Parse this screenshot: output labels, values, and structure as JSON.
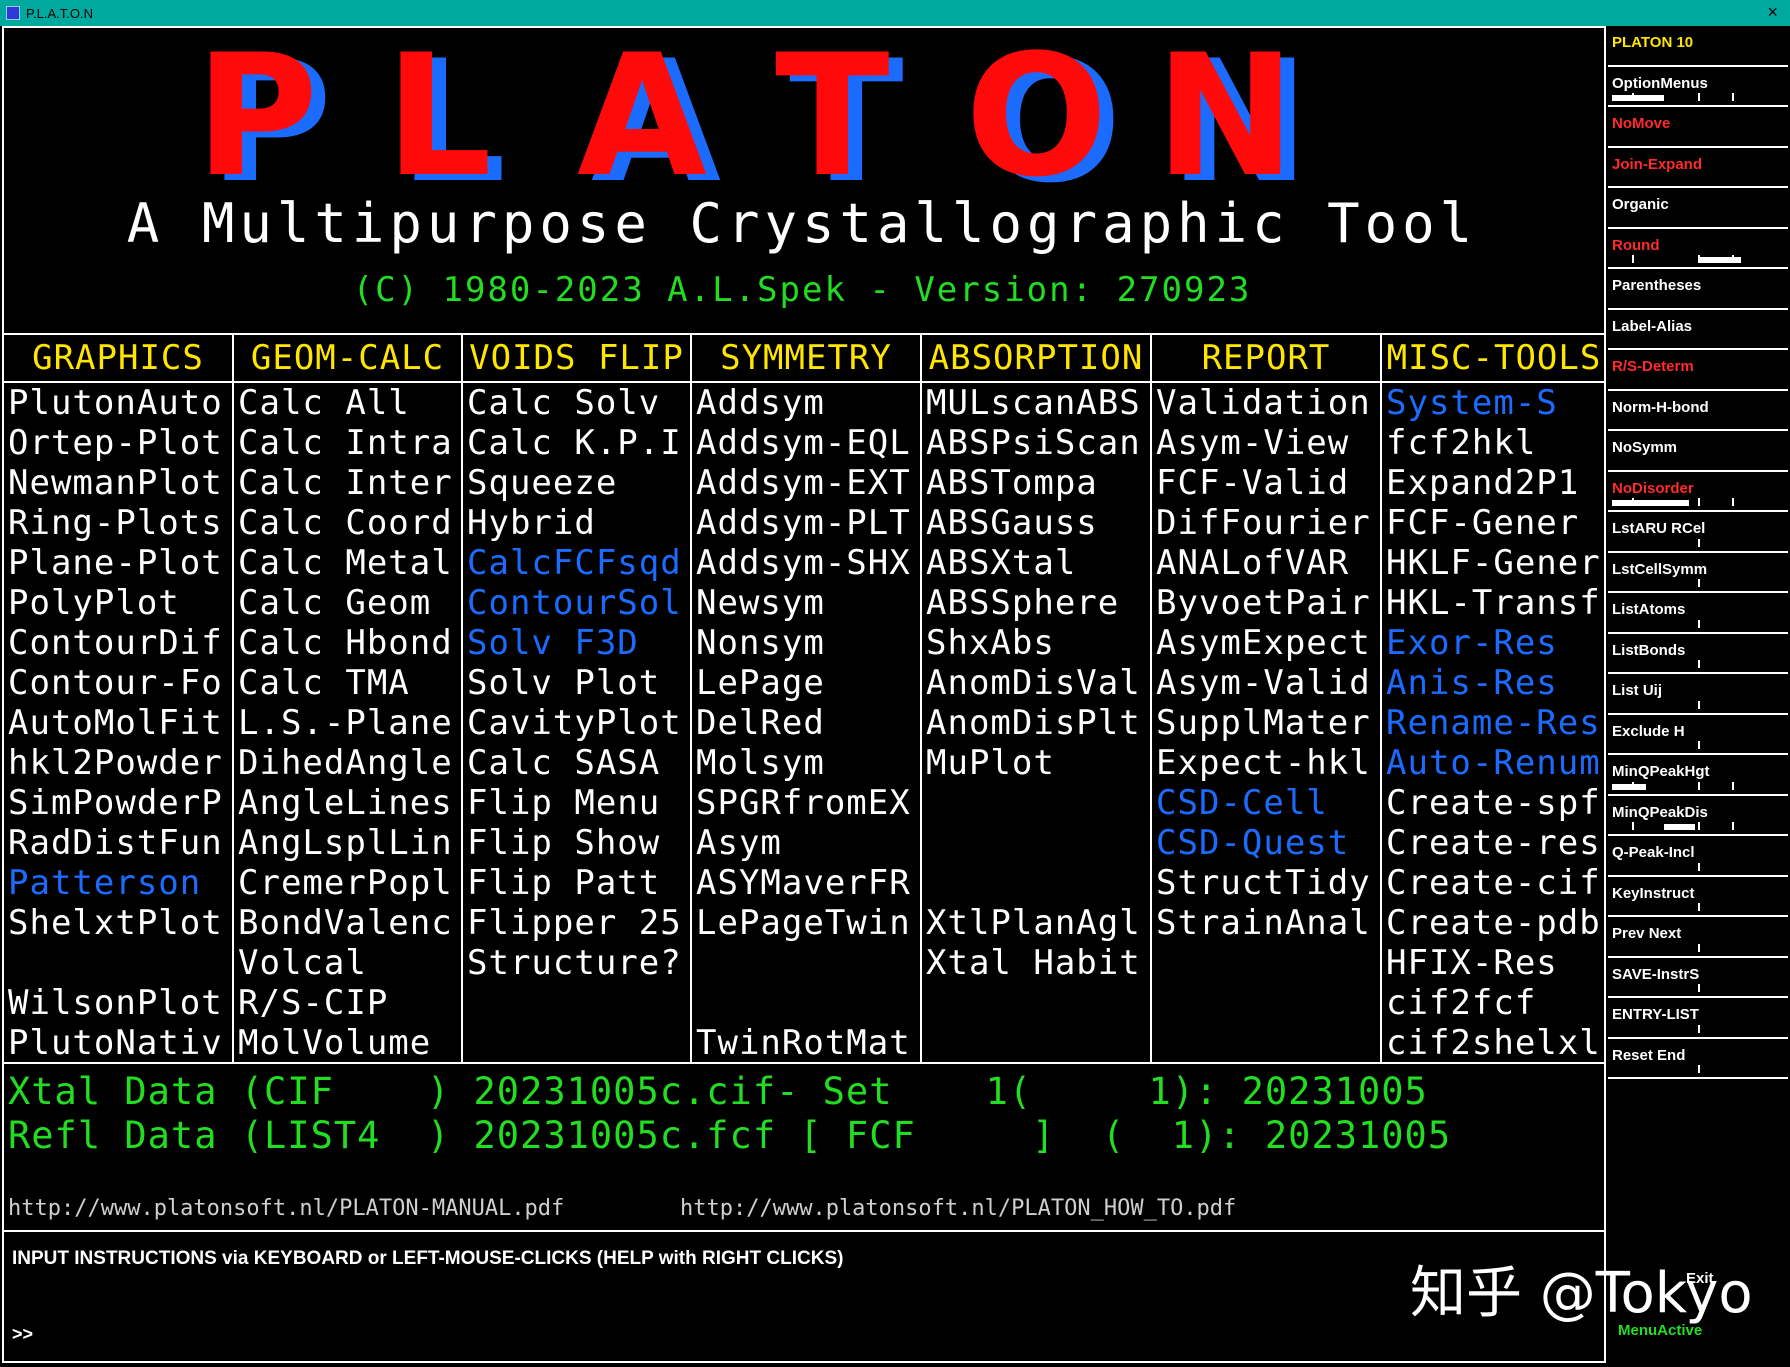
{
  "window": {
    "title": "P.L.A.T.O.N",
    "close_glyph": "×"
  },
  "logo": {
    "letters": [
      "P",
      "L",
      "A",
      "T",
      "O",
      "N"
    ],
    "colors": {
      "primary": "#ff0a0a",
      "shadow": "#1c6bff"
    }
  },
  "subtitle": "A Multipurpose Crystallographic Tool",
  "copyright": "(C) 1980-2023 A.L.Spek - Version: 270923",
  "colors": {
    "header": "#ffe600",
    "green": "#22dd22",
    "blue": "#1c6bff",
    "red": "#ff2a2a",
    "white": "#ffffff"
  },
  "columns": [
    {
      "header": "GRAPHICS",
      "items": [
        {
          "t": "PlutonAuto"
        },
        {
          "t": "Ortep-Plot"
        },
        {
          "t": "NewmanPlot"
        },
        {
          "t": "Ring-Plots"
        },
        {
          "t": "Plane-Plot"
        },
        {
          "t": "PolyPlot"
        },
        {
          "t": "ContourDif"
        },
        {
          "t": "Contour-Fo"
        },
        {
          "t": "AutoMolFit"
        },
        {
          "t": "hkl2Powder"
        },
        {
          "t": "SimPowderP"
        },
        {
          "t": "RadDistFun"
        },
        {
          "t": "Patterson",
          "c": "blue"
        },
        {
          "t": "ShelxtPlot"
        },
        {
          "t": ""
        },
        {
          "t": "WilsonPlot"
        },
        {
          "t": "PlutoNativ"
        }
      ]
    },
    {
      "header": "GEOM-CALC",
      "items": [
        {
          "t": "Calc All"
        },
        {
          "t": "Calc Intra"
        },
        {
          "t": "Calc Inter"
        },
        {
          "t": "Calc Coord"
        },
        {
          "t": "Calc Metal"
        },
        {
          "t": "Calc Geom"
        },
        {
          "t": "Calc Hbond"
        },
        {
          "t": "Calc TMA"
        },
        {
          "t": "L.S.-Plane"
        },
        {
          "t": "DihedAngle"
        },
        {
          "t": "AngleLines"
        },
        {
          "t": "AngLsplLin"
        },
        {
          "t": "CremerPopl"
        },
        {
          "t": "BondValenc"
        },
        {
          "t": "Volcal"
        },
        {
          "t": "R/S-CIP"
        },
        {
          "t": "MolVolume"
        }
      ]
    },
    {
      "header": "VOIDS FLIP",
      "items": [
        {
          "t": "Calc Solv"
        },
        {
          "t": "Calc K.P.I"
        },
        {
          "t": "Squeeze"
        },
        {
          "t": "Hybrid"
        },
        {
          "t": "CalcFCFsqd",
          "c": "blue"
        },
        {
          "t": "ContourSol",
          "c": "blue"
        },
        {
          "t": "Solv F3D",
          "c": "blue"
        },
        {
          "t": "Solv Plot"
        },
        {
          "t": "CavityPlot"
        },
        {
          "t": "Calc SASA"
        },
        {
          "t": "Flip Menu"
        },
        {
          "t": "Flip Show"
        },
        {
          "t": "Flip Patt"
        },
        {
          "t": "Flipper 25"
        },
        {
          "t": "Structure?"
        },
        {
          "t": ""
        },
        {
          "t": ""
        }
      ]
    },
    {
      "header": "SYMMETRY",
      "items": [
        {
          "t": "Addsym"
        },
        {
          "t": "Addsym-EQL"
        },
        {
          "t": "Addsym-EXT"
        },
        {
          "t": "Addsym-PLT"
        },
        {
          "t": "Addsym-SHX"
        },
        {
          "t": "Newsym"
        },
        {
          "t": "Nonsym"
        },
        {
          "t": "LePage"
        },
        {
          "t": "DelRed"
        },
        {
          "t": "Molsym"
        },
        {
          "t": "SPGRfromEX"
        },
        {
          "t": "Asym"
        },
        {
          "t": "ASYMaverFR"
        },
        {
          "t": "LePageTwin"
        },
        {
          "t": ""
        },
        {
          "t": ""
        },
        {
          "t": "TwinRotMat"
        }
      ]
    },
    {
      "header": "ABSORPTION",
      "items": [
        {
          "t": "MULscanABS"
        },
        {
          "t": "ABSPsiScan"
        },
        {
          "t": "ABSTompa"
        },
        {
          "t": "ABSGauss"
        },
        {
          "t": "ABSXtal"
        },
        {
          "t": "ABSSphere"
        },
        {
          "t": "ShxAbs"
        },
        {
          "t": "AnomDisVal"
        },
        {
          "t": "AnomDisPlt"
        },
        {
          "t": "MuPlot"
        },
        {
          "t": ""
        },
        {
          "t": ""
        },
        {
          "t": ""
        },
        {
          "t": "XtlPlanAgl"
        },
        {
          "t": "Xtal Habit"
        },
        {
          "t": ""
        },
        {
          "t": ""
        }
      ]
    },
    {
      "header": "REPORT",
      "items": [
        {
          "t": "Validation"
        },
        {
          "t": "Asym-View"
        },
        {
          "t": "FCF-Valid"
        },
        {
          "t": "DifFourier"
        },
        {
          "t": "ANALofVAR"
        },
        {
          "t": "ByvoetPair"
        },
        {
          "t": "AsymExpect"
        },
        {
          "t": "Asym-Valid"
        },
        {
          "t": "SupplMater"
        },
        {
          "t": "Expect-hkl"
        },
        {
          "t": "CSD-Cell",
          "c": "blue"
        },
        {
          "t": "CSD-Quest",
          "c": "blue"
        },
        {
          "t": "StructTidy"
        },
        {
          "t": "StrainAnal"
        },
        {
          "t": ""
        },
        {
          "t": ""
        },
        {
          "t": ""
        }
      ]
    },
    {
      "header": "MISC-TOOLS",
      "items": [
        {
          "t": "System-S",
          "c": "blue"
        },
        {
          "t": "fcf2hkl"
        },
        {
          "t": "Expand2P1"
        },
        {
          "t": "FCF-Gener"
        },
        {
          "t": "HKLF-Gener"
        },
        {
          "t": "HKL-Transf"
        },
        {
          "t": "Exor-Res",
          "c": "blue"
        },
        {
          "t": "Anis-Res",
          "c": "blue"
        },
        {
          "t": "Rename-Res",
          "c": "blue"
        },
        {
          "t": "Auto-Renum",
          "c": "blue"
        },
        {
          "t": "Create-spf"
        },
        {
          "t": "Create-res"
        },
        {
          "t": "Create-cif"
        },
        {
          "t": "Create-pdb"
        },
        {
          "t": "HFIX-Res"
        },
        {
          "t": "cif2fcf"
        },
        {
          "t": "cif2shelxl"
        }
      ]
    }
  ],
  "xtal_data": "Xtal Data (CIF    ) 20231005c.cif- Set    1(     1): 20231005",
  "refl_data": "Refl Data (LIST4  ) 20231005c.fcf [ FCF     ]  (  1): 20231005",
  "urls": {
    "manual": "http://www.platonsoft.nl/PLATON-MANUAL.pdf",
    "howto": "http://www.platonsoft.nl/PLATON_HOW_TO.pdf"
  },
  "instructions": "INPUT INSTRUCTIONS via KEYBOARD or LEFT-MOUSE-CLICKS (HELP with RIGHT CLICKS)",
  "prompt": ">>",
  "watermark": "知乎 @Tokyo",
  "panel": {
    "buttons": [
      {
        "label": "PLATON   10",
        "color": "#ffe600",
        "slider": "none"
      },
      {
        "label": "OptionMenus",
        "color": "#ffffff",
        "slider": "left",
        "fill": 0.3
      },
      {
        "label": "NoMove",
        "color": "#ff2a2a",
        "slider": "none"
      },
      {
        "label": "Join-Expand",
        "color": "#ff2a2a",
        "slider": "none"
      },
      {
        "label": "Organic",
        "color": "#ffffff",
        "slider": "none"
      },
      {
        "label": "Round",
        "color": "#ff2a2a",
        "slider": "right",
        "fill": 0.25
      },
      {
        "label": "Parentheses",
        "color": "#ffffff",
        "slider": "none"
      },
      {
        "label": "Label-Alias",
        "color": "#ffffff",
        "slider": "none"
      },
      {
        "label": "R/S-Determ",
        "color": "#ff2a2a",
        "slider": "none"
      },
      {
        "label": "Norm-H-bond",
        "color": "#ffffff",
        "slider": "none"
      },
      {
        "label": "NoSymm",
        "color": "#ffffff",
        "slider": "none"
      },
      {
        "label": "NoDisorder",
        "color": "#ff2a2a",
        "slider": "full",
        "fill": 0.45
      },
      {
        "label": "LstARU RCel",
        "color": "#ffffff",
        "slider": "tick"
      },
      {
        "label": "LstCellSymm",
        "color": "#ffffff",
        "slider": "tick"
      },
      {
        "label": "ListAtoms",
        "color": "#ffffff",
        "slider": "tick"
      },
      {
        "label": "ListBonds",
        "color": "#ffffff",
        "slider": "tick"
      },
      {
        "label": "List Uij",
        "color": "#ffffff",
        "slider": "tick"
      },
      {
        "label": "Exclude H",
        "color": "#ffffff",
        "slider": "tick"
      },
      {
        "label": "MinQPeakHgt",
        "color": "#ffffff",
        "slider": "left",
        "fill": 0.2
      },
      {
        "label": "MinQPeakDis",
        "color": "#ffffff",
        "slider": "mid",
        "fill": 0.18
      },
      {
        "label": "Q-Peak-Incl",
        "color": "#ffffff",
        "slider": "tick"
      },
      {
        "label": "KeyInstruct",
        "color": "#ffffff",
        "slider": "tick"
      },
      {
        "label": "Prev   Next",
        "color": "#ffffff",
        "slider": "tick"
      },
      {
        "label": "SAVE-InstrS",
        "color": "#ffffff",
        "slider": "tick"
      },
      {
        "label": "ENTRY-LIST",
        "color": "#ffffff",
        "slider": "tick"
      },
      {
        "label": "Reset   End",
        "color": "#ffffff",
        "slider": "tick"
      }
    ],
    "exit_label": "Exit",
    "menuactive_label": "MenuActive"
  }
}
